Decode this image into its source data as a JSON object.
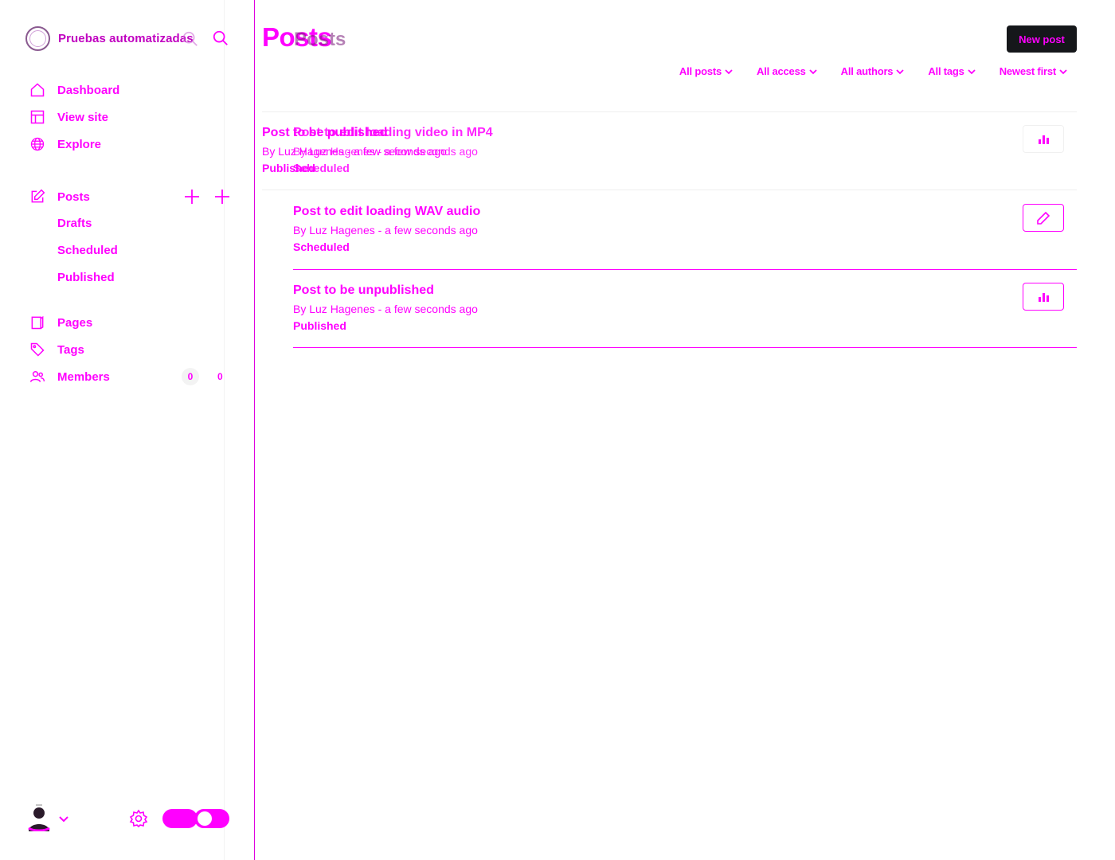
{
  "sidebar": {
    "site_name": "Pruebas automatizadas",
    "nav": {
      "dashboard": "Dashboard",
      "view_site": "View site",
      "explore": "Explore",
      "posts": "Posts",
      "drafts": "Drafts",
      "scheduled": "Scheduled",
      "published": "Published",
      "pages": "Pages",
      "tags": "Tags",
      "members": "Members",
      "members_count": "0"
    },
    "icons": [
      "search-icon",
      "home-icon",
      "layout-icon",
      "globe-icon",
      "edit-icon",
      "plus-icon",
      "page-icon",
      "tag-icon",
      "members-icon",
      "avatar-icon",
      "chevron-down-icon",
      "gear-icon",
      "toggle-icon"
    ]
  },
  "header": {
    "title": "Posts",
    "new_post_label": "New post",
    "filters": [
      "All posts",
      "All access",
      "All authors",
      "All tags",
      "Newest first"
    ]
  },
  "posts": [
    {
      "title": "Post to be published",
      "meta": "By Luz Hagenes - a few seconds ago",
      "status": "Published",
      "action_icon": "stats-icon"
    },
    {
      "title": "Post to edit loading video in MP4",
      "meta": "By Luz Hagenes - a few seconds ago",
      "status": "Scheduled",
      "action_icon": "stats-icon"
    },
    {
      "title": "Post to edit loading WAV audio",
      "meta": "By Luz Hagenes - a few seconds ago",
      "status": "Scheduled",
      "action_icon": "pencil-icon"
    },
    {
      "title": "Post to be unpublished",
      "meta": "By Luz Hagenes - a few seconds ago",
      "status": "Published",
      "action_icon": "stats-icon"
    }
  ],
  "colors": {
    "accent": "#ff00ff",
    "button_bg": "#15171a",
    "divider": "#eeeeee"
  }
}
